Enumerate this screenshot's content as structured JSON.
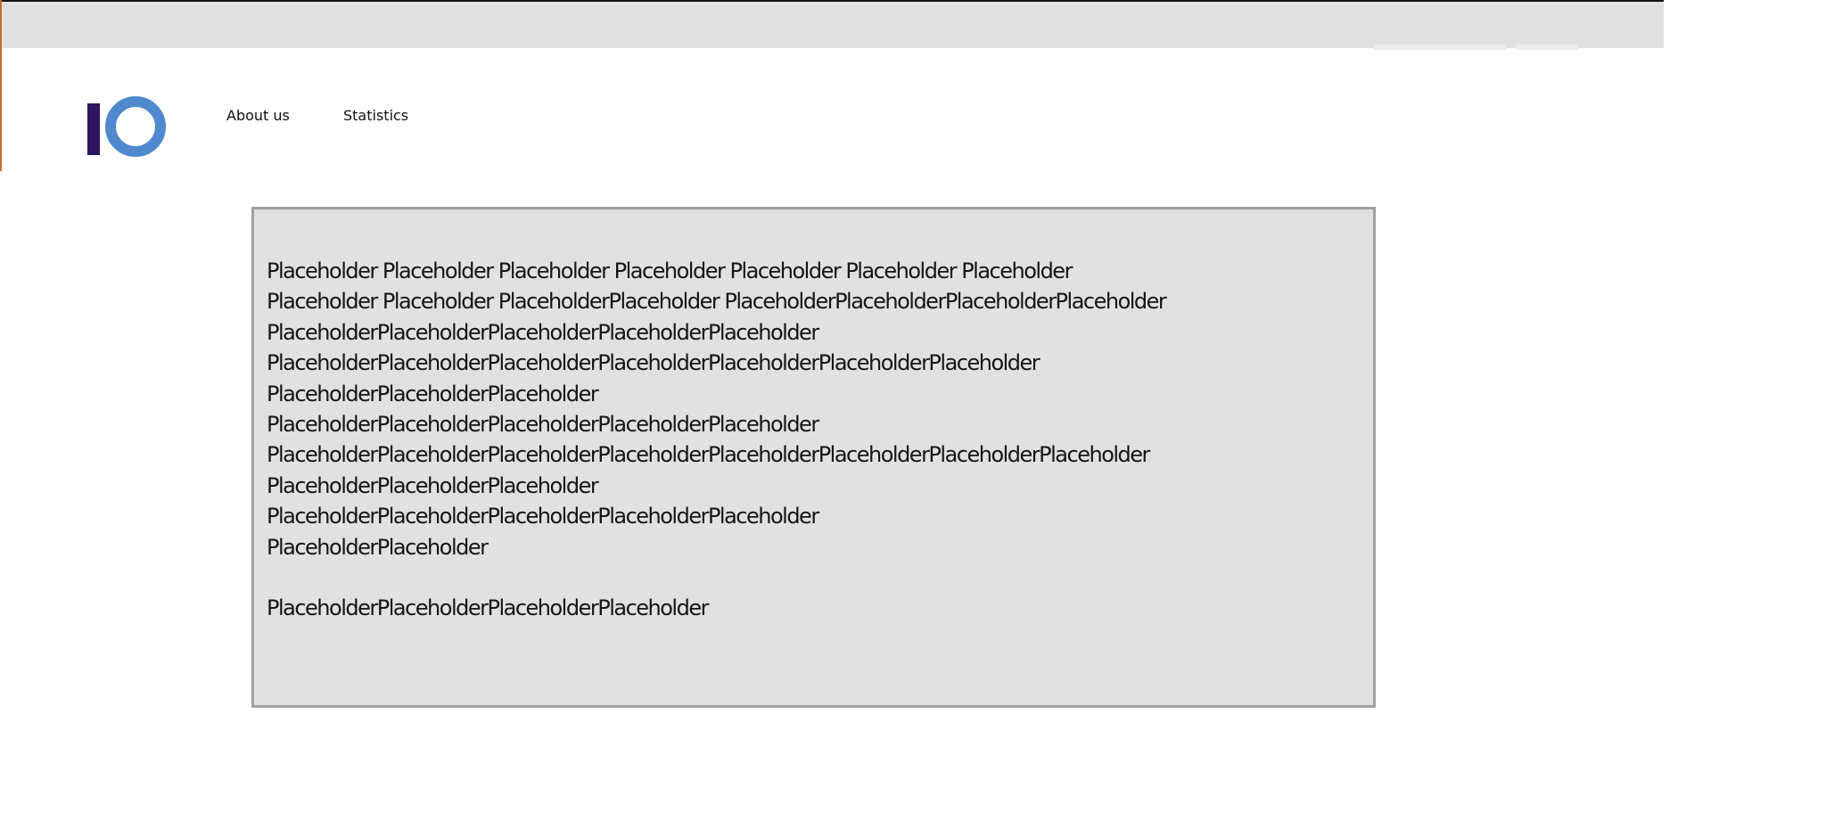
{
  "header": {
    "logo_text": "IO",
    "nav": [
      {
        "label": "About us"
      },
      {
        "label": "Statistics"
      }
    ]
  },
  "content": {
    "lines": [
      "Placeholder Placeholder Placeholder Placeholder Placeholder Placeholder Placeholder",
      "Placeholder Placeholder PlaceholderPlaceholder PlaceholderPlaceholderPlaceholderPlaceholder",
      "PlaceholderPlaceholderPlaceholderPlaceholderPlaceholder",
      "PlaceholderPlaceholderPlaceholderPlaceholderPlaceholderPlaceholderPlaceholder",
      "PlaceholderPlaceholderPlaceholder",
      "PlaceholderPlaceholderPlaceholderPlaceholderPlaceholder",
      "PlaceholderPlaceholderPlaceholderPlaceholderPlaceholderPlaceholderPlaceholderPlaceholder",
      "PlaceholderPlaceholderPlaceholder",
      "PlaceholderPlaceholderPlaceholderPlaceholderPlaceholder",
      "PlaceholderPlaceholder",
      "",
      "PlaceholderPlaceholderPlaceholderPlaceholder"
    ]
  },
  "colors": {
    "top_bar": "#e1e1e1",
    "content_bg": "#e1e1e1",
    "content_border": "#a1a1a1",
    "logo_bar": "#2e1460",
    "logo_ring": "#5189cf",
    "left_accent": "#c8702a"
  }
}
